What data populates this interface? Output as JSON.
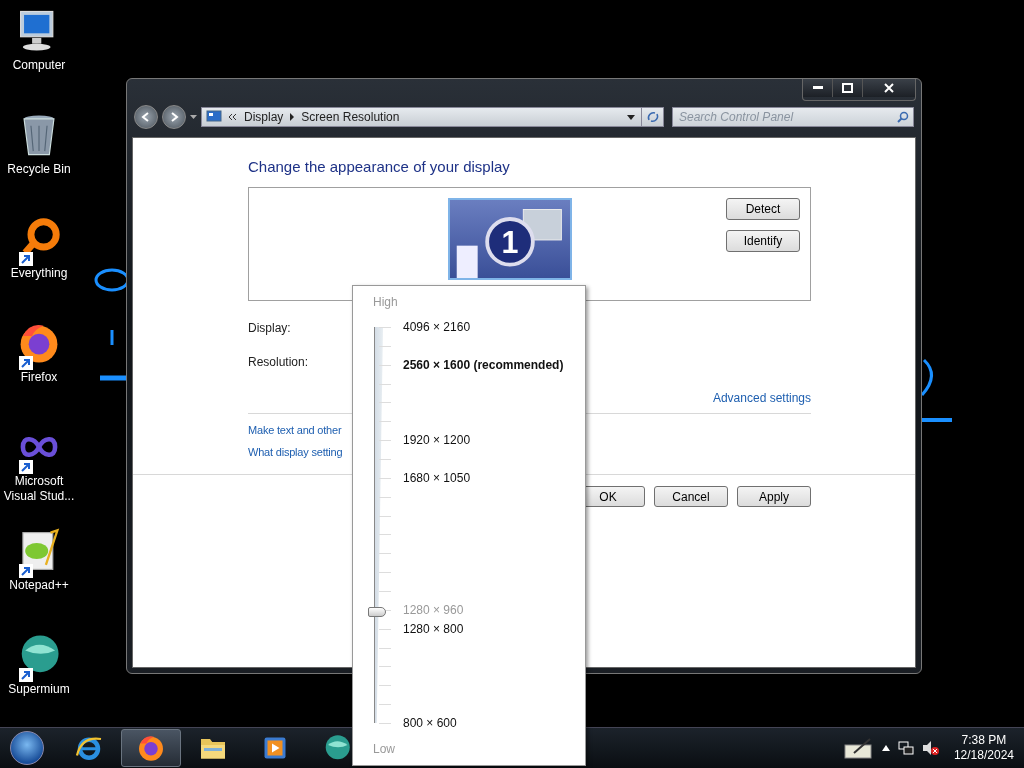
{
  "desktop_icons": [
    {
      "label": "Computer",
      "kind": "computer",
      "shortcut": false
    },
    {
      "label": "Recycle Bin",
      "kind": "recycle",
      "shortcut": false
    },
    {
      "label": "Everything",
      "kind": "ring",
      "shortcut": true
    },
    {
      "label": "Firefox",
      "kind": "firefox",
      "shortcut": true
    },
    {
      "label": "Microsoft Visual Stud...",
      "kind": "infinity",
      "shortcut": true
    },
    {
      "label": "Notepad++",
      "kind": "notepad",
      "shortcut": true
    },
    {
      "label": "Supermium",
      "kind": "supermium",
      "shortcut": true
    }
  ],
  "window": {
    "address_bar": {
      "crumbs": [
        "Display",
        "Screen Resolution"
      ]
    },
    "search": {
      "placeholder": "Search Control Panel"
    },
    "heading": "Change the appearance of your display",
    "monitor": {
      "number": "1"
    },
    "side_buttons": [
      "Detect",
      "Identify"
    ],
    "fields": [
      {
        "label": "Display:"
      },
      {
        "label": "Resolution:"
      }
    ],
    "advanced_link": "Advanced settings",
    "links": [
      "Make text and other",
      "What display setting"
    ],
    "dialog_buttons": [
      "OK",
      "Cancel",
      "Apply"
    ]
  },
  "resolution_popup": {
    "high_label": "High",
    "low_label": "Low",
    "level": 0.28,
    "options": [
      {
        "text": "4096 × 2160",
        "kind": "option"
      },
      {
        "text": "2560 × 1600 (recommended)",
        "kind": "recommended"
      },
      {
        "text": "1920 × 1200",
        "kind": "option"
      },
      {
        "text": "1680 × 1050",
        "kind": "option"
      },
      {
        "text": "1280 × 960",
        "kind": "current"
      },
      {
        "text": "1280 × 800",
        "kind": "option"
      },
      {
        "text": "800 × 600",
        "kind": "option"
      }
    ]
  },
  "taskbar": {
    "apps": [
      {
        "kind": "ie",
        "selected": false
      },
      {
        "kind": "firefox",
        "selected": true
      },
      {
        "kind": "folder",
        "selected": false
      },
      {
        "kind": "media",
        "selected": false
      },
      {
        "kind": "supermium",
        "selected": false
      }
    ],
    "clock": {
      "time": "7:38 PM",
      "date": "12/18/2024"
    }
  }
}
